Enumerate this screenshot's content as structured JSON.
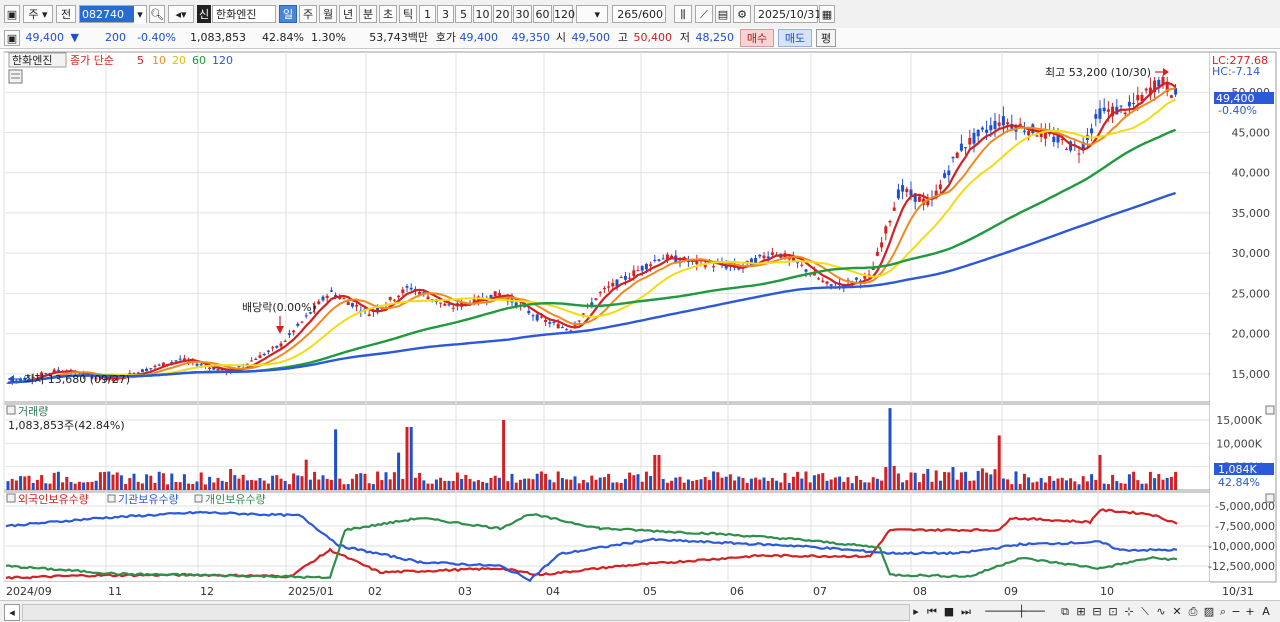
{
  "toolbar": {
    "period_label": "주",
    "prev_label": "전",
    "stock_code": "082740",
    "stock_name": "한화엔진",
    "credit_badge": "신",
    "periods": [
      "일",
      "주",
      "월",
      "년",
      "분",
      "초",
      "틱"
    ],
    "selected_period": "일",
    "intervals": [
      "1",
      "3",
      "5",
      "10",
      "20",
      "30",
      "60",
      "120"
    ],
    "range_value": "265",
    "range_total": "/600",
    "date": "2025/10/31"
  },
  "quote": {
    "price": "49,400",
    "change_arrow": "▼",
    "change": "200",
    "change_pct": "-0.40%",
    "volume": "1,083,853",
    "turnover_ratio": "42.84%",
    "ratio2": "1.30%",
    "amount": "53,743백만",
    "bid_ask_label": "호가",
    "ask": "49,400",
    "bid": "49,350",
    "open_label": "시",
    "open": "49,500",
    "high_label": "고",
    "high": "50,400",
    "low_label": "저",
    "low": "48,250",
    "buy_button": "매수",
    "sell_button": "매도",
    "eval_button": "평"
  },
  "price_panel": {
    "name_tag": "한화엔진",
    "legend_prefix": "종가 단순",
    "ma_labels": [
      "5",
      "10",
      "20",
      "60",
      "120"
    ],
    "ma_colors": [
      "#d42020",
      "#f08a1e",
      "#f2dc12",
      "#1f9a3c",
      "#2b59d9"
    ],
    "lc_label": "LC:277.68",
    "hc_label": "HC:-7.14",
    "current_price_tag": "49,400",
    "current_change_tag": "-0.40%",
    "max_annotation": "최고 53,200 (10/30)",
    "min_annotation": "최저 13,680 (09/27)",
    "dividend_annotation": "배당락(0.00%)"
  },
  "volume_panel": {
    "title": "거래량",
    "volume_text": "1,083,853주(42.84%)",
    "current_tag": "1,084K",
    "current_pct": "42.84%"
  },
  "holdings_panel": {
    "legend": [
      "외국인보유수량",
      "기관보유수량",
      "개인보유수량"
    ],
    "colors": [
      "#d42020",
      "#2b59d9",
      "#2f8f4a"
    ]
  },
  "x_axis": {
    "labels": [
      "2024/09",
      "11",
      "12",
      "2025/01",
      "02",
      "03",
      "04",
      "05",
      "06",
      "07",
      "08",
      "09",
      "10"
    ],
    "end_label": "10/31"
  },
  "chart_data": {
    "type": "line",
    "series": [],
    "y_axis_price": [
      "50,000",
      "45,000",
      "40,000",
      "35,000",
      "30,000",
      "25,000",
      "20,000",
      "15,000"
    ],
    "y_axis_volume": [
      "15,000K",
      "10,000K",
      "5,000K"
    ],
    "y_axis_holdings": [
      "-5,000,000",
      "-7,500,000",
      "-10,000,000",
      "-12,500,000"
    ],
    "moving_averages": [
      "5",
      "10",
      "20",
      "60",
      "120"
    ],
    "price_high": 53200,
    "price_low": 13680,
    "last_close": 49400
  }
}
